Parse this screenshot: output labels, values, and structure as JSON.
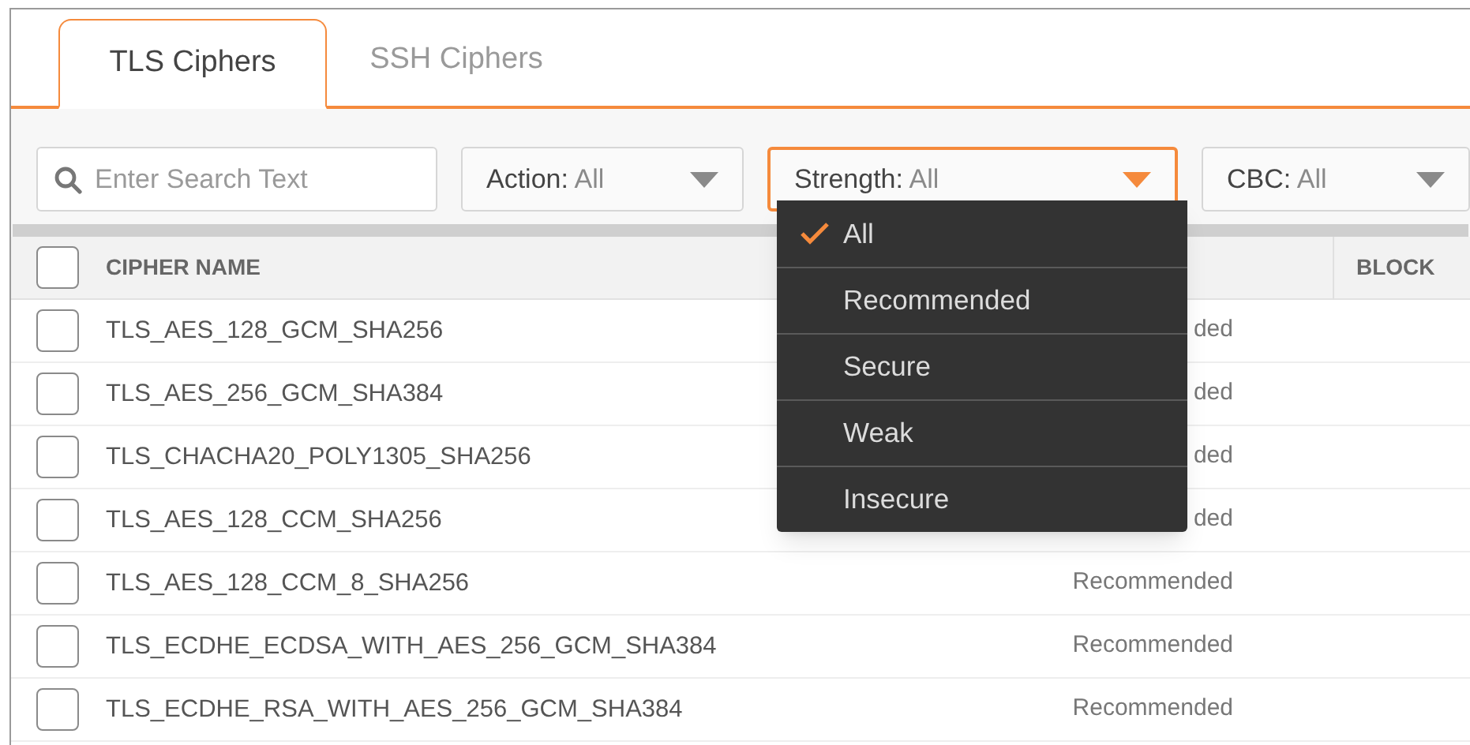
{
  "tabs": [
    {
      "label": "TLS Ciphers",
      "selected": true
    },
    {
      "label": "SSH Ciphers",
      "selected": false
    }
  ],
  "search": {
    "placeholder": "Enter Search Text"
  },
  "filters": [
    {
      "label": "Action:",
      "value": "All",
      "open": false
    },
    {
      "label": "Strength:",
      "value": "All",
      "open": true
    },
    {
      "label": "CBC:",
      "value": "All",
      "open": false
    }
  ],
  "dropdown": {
    "options": [
      {
        "label": "All",
        "selected": true
      },
      {
        "label": "Recommended",
        "selected": false
      },
      {
        "label": "Secure",
        "selected": false
      },
      {
        "label": "Weak",
        "selected": false
      },
      {
        "label": "Insecure",
        "selected": false
      }
    ]
  },
  "table": {
    "columns": [
      "CIPHER NAME",
      "BLOCK"
    ],
    "all_checked": false,
    "rows": [
      {
        "name": "TLS_AES_128_GCM_SHA256",
        "strength": "ded",
        "checked": false
      },
      {
        "name": "TLS_AES_256_GCM_SHA384",
        "strength": "ded",
        "checked": false
      },
      {
        "name": "TLS_CHACHA20_POLY1305_SHA256",
        "strength": "ded",
        "checked": false
      },
      {
        "name": "TLS_AES_128_CCM_SHA256",
        "strength": "ded",
        "checked": false
      },
      {
        "name": "TLS_AES_128_CCM_8_SHA256",
        "strength": "Recommended",
        "checked": false
      },
      {
        "name": "TLS_ECDHE_ECDSA_WITH_AES_256_GCM_SHA384",
        "strength": "Recommended",
        "checked": false
      },
      {
        "name": "TLS_ECDHE_RSA_WITH_AES_256_GCM_SHA384",
        "strength": "Recommended",
        "checked": false
      }
    ]
  }
}
